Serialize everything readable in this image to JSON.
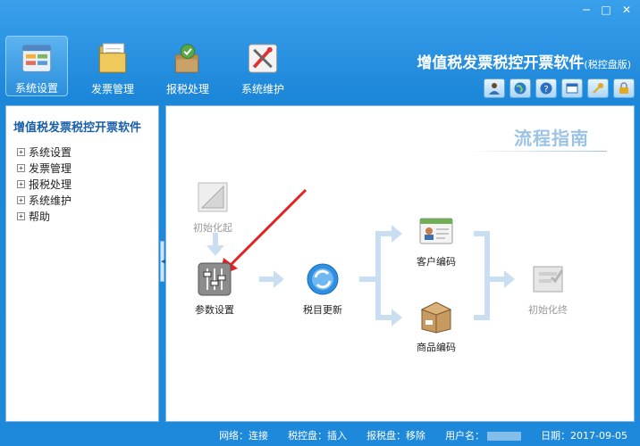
{
  "window": {
    "minimize": "─",
    "maximize": "□",
    "close": "✕"
  },
  "toolbar": {
    "items": [
      {
        "label": "系统设置",
        "icon": "settings-panel-icon",
        "active": true
      },
      {
        "label": "发票管理",
        "icon": "folder-icon",
        "active": false
      },
      {
        "label": "报税处理",
        "icon": "tax-box-icon",
        "active": false
      },
      {
        "label": "系统维护",
        "icon": "tools-icon",
        "active": false
      }
    ]
  },
  "app": {
    "title": "增值税发票税控开票软件",
    "edition": "(税控盘版)"
  },
  "iconbar": [
    {
      "icon": "user-icon"
    },
    {
      "icon": "globe-icon"
    },
    {
      "icon": "help-icon"
    },
    {
      "icon": "window-icon"
    },
    {
      "icon": "key-icon"
    },
    {
      "icon": "lock-icon"
    }
  ],
  "sidebar": {
    "title": "增值税发票税控开票软件",
    "items": [
      {
        "label": "系统设置"
      },
      {
        "label": "发票管理"
      },
      {
        "label": "报税处理"
      },
      {
        "label": "系统维护"
      },
      {
        "label": "帮助"
      }
    ]
  },
  "guide": {
    "title": "流程指南",
    "nodes": {
      "init_start": "初始化起",
      "params": "参数设置",
      "tax_update": "税目更新",
      "customer_code": "客户编码",
      "product_code": "商品编码",
      "init_end": "初始化终"
    }
  },
  "status": {
    "network": "网络：连接",
    "tax_disk": "税控盘：插入",
    "report_disk": "报税盘：移除",
    "user_label": "用户名：",
    "date": "日期：2017-09-05"
  },
  "colors": {
    "accent": "#1e88d8",
    "panel_border": "#7fb8e6",
    "arrow_red": "#e02424"
  }
}
